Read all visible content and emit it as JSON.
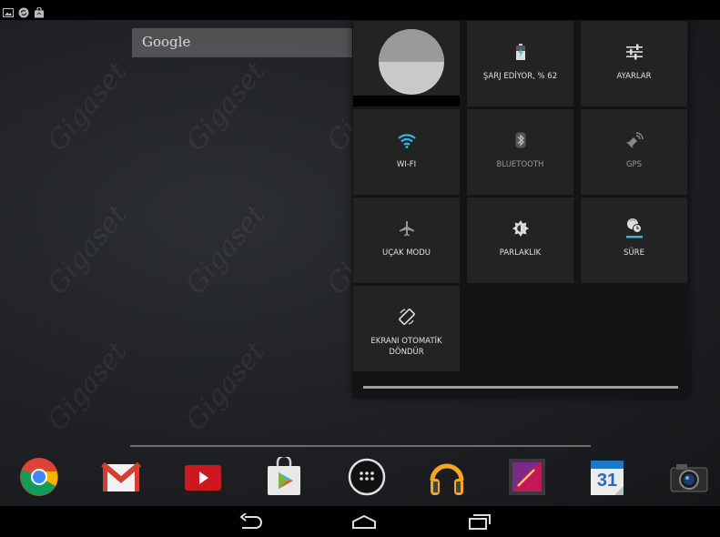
{
  "status_bar": {
    "icons": [
      "image-notification-icon",
      "sync-notification-icon",
      "shopping-bag-notification-icon"
    ]
  },
  "wallpaper": {
    "watermark": "Gigaset"
  },
  "search": {
    "label": "Google"
  },
  "quick_settings": {
    "battery": {
      "label": "ŞARJ EDİYOR, % 62",
      "icon": "battery-charging-icon"
    },
    "settings": {
      "label": "AYARLAR",
      "icon": "sliders-icon"
    },
    "wifi": {
      "label": "WI-FI",
      "icon": "wifi-icon",
      "active_color": "#33b5e5"
    },
    "bluetooth": {
      "label": "BLUETOOTH",
      "icon": "bluetooth-icon"
    },
    "gps": {
      "label": "GPS",
      "icon": "gps-icon"
    },
    "airplane": {
      "label": "UÇAK MODU",
      "icon": "airplane-icon"
    },
    "brightness": {
      "label": "PARLAKLIK",
      "icon": "brightness-icon"
    },
    "timeout": {
      "label": "SÜRE",
      "icon": "timer-icon"
    },
    "rotate_line1": "EKRANI OTOMATİK",
    "rotate_line2": "DÖNDÜR",
    "rotate_icon": "screen-rotate-icon"
  },
  "dock": {
    "apps": [
      "Chrome",
      "Gmail",
      "YouTube",
      "Play Store",
      "All Apps",
      "Play Music",
      "Gallery",
      "Calendar",
      "Camera"
    ],
    "calendar_day": "31"
  },
  "nav_bar": {
    "buttons": [
      "back",
      "home",
      "recent-apps"
    ]
  },
  "colors": {
    "accent": "#33b5e5",
    "panel_bg": "#141414",
    "tile_bg": "#232323"
  }
}
